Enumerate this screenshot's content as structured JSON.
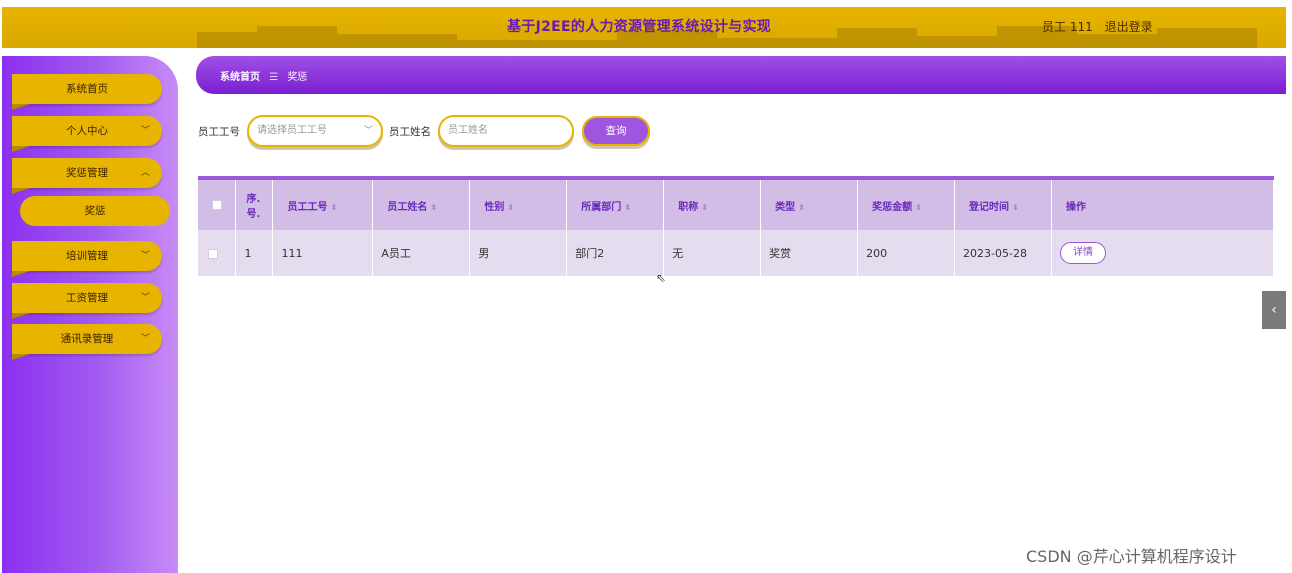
{
  "header": {
    "title": "基于J2EE的人力资源管理系统设计与实现",
    "user_label": "员工 111",
    "logout": "退出登录"
  },
  "sidebar": {
    "items": [
      {
        "label": "系统首页"
      },
      {
        "label": "个人中心",
        "chevron": "﹀"
      },
      {
        "label": "奖惩管理",
        "chevron": "︿"
      },
      {
        "label": "奖惩"
      },
      {
        "label": "培训管理",
        "chevron": "﹀"
      },
      {
        "label": "工资管理",
        "chevron": "﹀"
      },
      {
        "label": "通讯录管理",
        "chevron": "﹀"
      }
    ]
  },
  "breadcrumb": {
    "home": "系统首页",
    "sep_icon": "☰",
    "current": "奖惩"
  },
  "search": {
    "emp_no_label": "员工工号",
    "emp_no_placeholder": "请选择员工工号",
    "emp_name_label": "员工姓名",
    "emp_name_placeholder": "员工姓名",
    "query_button": "查询"
  },
  "table": {
    "headers": [
      "序.号.",
      "员工工号",
      "员工姓名",
      "性别",
      "所属部门",
      "职称",
      "类型",
      "奖惩金额",
      "登记时间",
      "操作"
    ],
    "rows": [
      {
        "index": "1",
        "emp_no": "111",
        "name": "A员工",
        "gender": "男",
        "dept": "部门2",
        "title": "无",
        "type": "奖赏",
        "amount": "200",
        "date": "2023-05-28",
        "action": "详情"
      }
    ]
  },
  "edge_tab_icon": "‹",
  "watermark": "CSDN @芹心计算机程序设计"
}
